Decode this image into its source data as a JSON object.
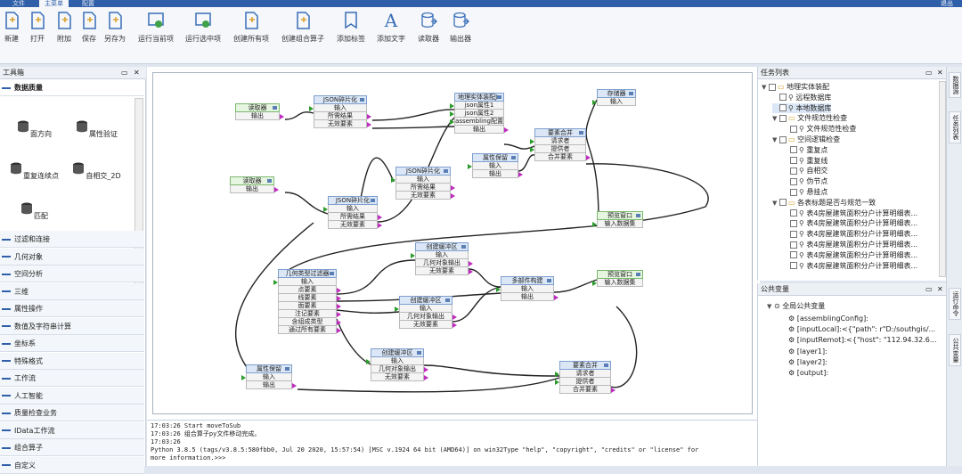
{
  "menu": {
    "tabs": [
      "文件",
      "主菜单",
      "配置"
    ],
    "exit": "退出"
  },
  "toolbar": {
    "items": [
      "新建",
      "打开",
      "附加",
      "保存",
      "另存为",
      "运行当前项",
      "运行选中项",
      "创建所有项",
      "创建组合算子",
      "添加标签",
      "添加文字",
      "读取器",
      "输出器"
    ]
  },
  "toolbox": {
    "title": "工具箱",
    "section": "数据质量",
    "tools": [
      "面方向",
      "属性验证",
      "重复连续点",
      "自相交_2D",
      "匹配"
    ],
    "groups": [
      "过滤和连接",
      "几何对象",
      "空间分析",
      "三维",
      "属性操作",
      "数值及字符串计算",
      "坐标系",
      "特殊格式",
      "工作流",
      "人工智能",
      "质量检查业务",
      "IData工作流",
      "组合算子",
      "自定义"
    ]
  },
  "canvas": {
    "nodes": [
      {
        "id": "n1",
        "title": "读取器",
        "ports": [
          "输出"
        ]
      },
      {
        "id": "n2",
        "title": "JSON碎片化",
        "ports": [
          "输入",
          "所需结果",
          "无效要素"
        ]
      },
      {
        "id": "n3",
        "title": "地理实体装配Js",
        "ports": [
          "json属性1",
          "json属性2",
          "assembling配置",
          "输出"
        ]
      },
      {
        "id": "n4",
        "title": "存储器",
        "ports": [
          "输入"
        ]
      },
      {
        "id": "n5",
        "title": "要素合并",
        "ports": [
          "请求者",
          "提供者",
          "合并要素"
        ]
      },
      {
        "id": "n6",
        "title": "属性保留",
        "ports": [
          "输入",
          "输出"
        ]
      },
      {
        "id": "n7",
        "title": "JSON碎片化",
        "ports": [
          "输入",
          "所需结果",
          "无效要素"
        ]
      },
      {
        "id": "n8",
        "title": "读取器",
        "ports": [
          "输出"
        ]
      },
      {
        "id": "n9",
        "title": "JSON碎片化",
        "ports": [
          "输入",
          "所需结果",
          "无效要素"
        ]
      },
      {
        "id": "n10",
        "title": "预览窗口",
        "ports": [
          "输入数据集"
        ]
      },
      {
        "id": "n11",
        "title": "创建缓冲区",
        "ports": [
          "输入",
          "几何对象输出",
          "无效要素"
        ]
      },
      {
        "id": "n12",
        "title": "几何类型过滤器",
        "ports": [
          "输入",
          "点要素",
          "线要素",
          "面要素",
          "注记要素",
          "含组成类型",
          "通过所有要素"
        ]
      },
      {
        "id": "n13",
        "title": "多部件构建",
        "ports": [
          "输入",
          "输出"
        ]
      },
      {
        "id": "n14",
        "title": "预览窗口",
        "ports": [
          "输入数据集"
        ]
      },
      {
        "id": "n15",
        "title": "创建缓冲区",
        "ports": [
          "输入",
          "几何对象输出",
          "无效要素"
        ]
      },
      {
        "id": "n16",
        "title": "创建缓冲区",
        "ports": [
          "输入",
          "几何对象输出",
          "无效要素"
        ]
      },
      {
        "id": "n17",
        "title": "属性保留",
        "ports": [
          "输入",
          "输出"
        ]
      },
      {
        "id": "n18",
        "title": "要素合并",
        "ports": [
          "请求者",
          "提供者",
          "合并要素"
        ]
      }
    ]
  },
  "log": {
    "lines": [
      "17:03:26 Start moveToSub",
      "17:03:26 组合算子py文件移动完成。",
      "17:03:26",
      "Python 3.8.5 (tags/v3.8.5:580fbb0, Jul 20 2020, 15:57:54) [MSC v.1924 64 bit (AMD64)] on win32Type \"help\", \"copyright\", \"credits\" or \"license\" for",
      "more information.>>>"
    ]
  },
  "tasks": {
    "title": "任务列表",
    "items": [
      {
        "label": "地理实体装配",
        "level": 0
      },
      {
        "label": "远程数据库",
        "level": 1
      },
      {
        "label": "本地数据库",
        "level": 1
      },
      {
        "label": "文件规范性检查",
        "level": 1
      },
      {
        "label": "文件规范性检查",
        "level": 2
      },
      {
        "label": "空间逻辑检查",
        "level": 1
      },
      {
        "label": "重复点",
        "level": 2
      },
      {
        "label": "重复线",
        "level": 2
      },
      {
        "label": "自相交",
        "level": 2
      },
      {
        "label": "伪节点",
        "level": 2
      },
      {
        "label": "悬挂点",
        "level": 2
      },
      {
        "label": "各表标题是否与规范一致",
        "level": 1
      },
      {
        "label": "表4房屋建筑面积分户计算明细表...",
        "level": 2
      },
      {
        "label": "表4房屋建筑面积分户计算明细表...",
        "level": 2
      },
      {
        "label": "表4房屋建筑面积分户计算明细表...",
        "level": 2
      },
      {
        "label": "表4房屋建筑面积分户计算明细表...",
        "level": 2
      },
      {
        "label": "表4房屋建筑面积分户计算明细表...",
        "level": 2
      },
      {
        "label": "表4房屋建筑面积分户计算明细表...",
        "level": 2
      }
    ]
  },
  "vars": {
    "title": "公共变量",
    "root": "全局公共变量",
    "items": [
      "[assemblingConfig]:<D:/southgis/应...",
      "[inputLocal]:<{\"path\": r\"D:/southgis/...",
      "[inputRemot]:<{\"host\": \"112.94.32.6...",
      "[layer1]:<entity_jmd>",
      "[layer2]:<entity_jmd_relation>",
      "[output]:<D:/southgis/1.mdb>"
    ]
  },
  "sidetabs": [
    "数据源",
    "任务列表",
    "运行命令",
    "公共变量"
  ]
}
